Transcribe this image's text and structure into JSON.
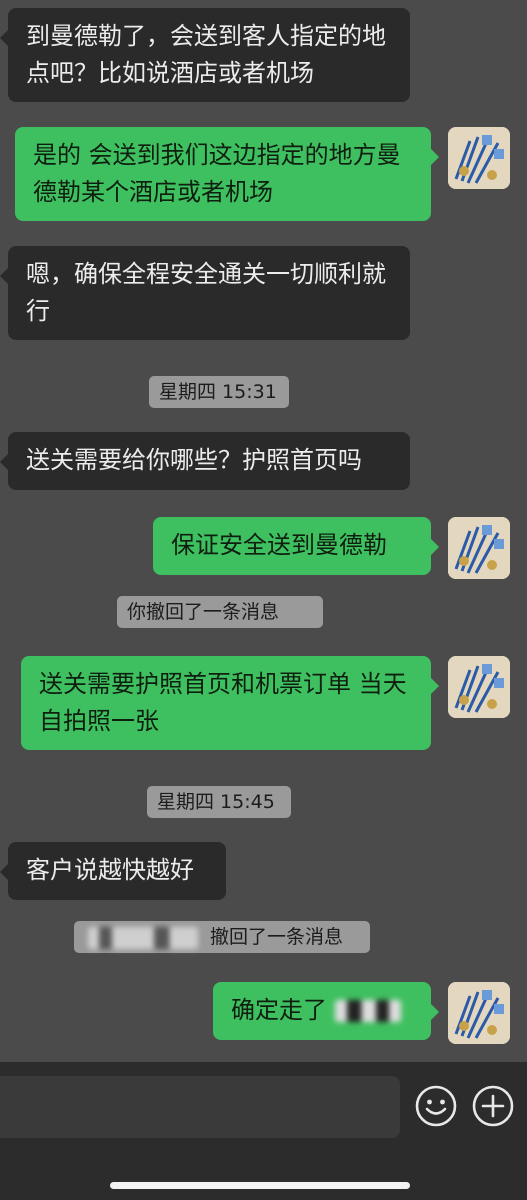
{
  "messages": [
    {
      "text": "到曼德勒了，会送到客人指定的地点吧？比如说酒店或者机场"
    },
    {
      "text": "是的 会送到我们这边指定的地方曼德勒某个酒店或者机场"
    },
    {
      "text": "嗯，确保全程安全通关一切顺利就行"
    },
    {
      "text": "送关需要给你哪些？护照首页吗"
    },
    {
      "text": "保证安全送到曼德勒"
    },
    {
      "text": "送关需要护照首页和机票订单 当天自拍照一张"
    },
    {
      "text": "客户说越快越好"
    },
    {
      "text": "确定走了"
    }
  ],
  "system": {
    "time1": "星期四 15:31",
    "recall_self": "你撤回了一条消息",
    "time2": "星期四 15:45",
    "recall_other": "撤回了一条消息"
  },
  "icons": {
    "emoji": "smiley-face-icon",
    "add": "plus-circle-icon"
  }
}
